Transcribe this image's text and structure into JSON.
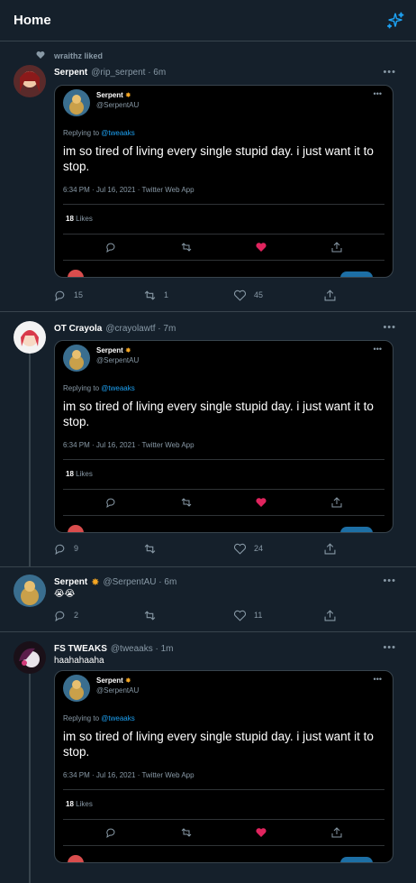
{
  "header": {
    "title": "Home",
    "icon": "sparkle-icon"
  },
  "quoted": {
    "name": "Serpent",
    "handle": "@SerpentAU",
    "replying_prefix": "Replying to",
    "replying_to": "@tweaaks",
    "text": "im so tired of living every single stupid day. i just want it to stop.",
    "meta": "6:34 PM · Jul 16, 2021 · Twitter Web App",
    "likes_count": "18",
    "likes_label": "Likes"
  },
  "tweets": [
    {
      "social": "wraithz liked",
      "name": "Serpent",
      "handle": "@rip_serpent · 6m",
      "replies": "15",
      "retweets": "1",
      "likes": "45"
    },
    {
      "name": "OT Crayola",
      "handle": "@crayolawtf · 7m",
      "replies": "9",
      "retweets": "",
      "likes": "24"
    },
    {
      "name": "Serpent",
      "handle": "@SerpentAU · 6m",
      "text": "😭😭",
      "replies": "2",
      "retweets": "",
      "likes": "11"
    },
    {
      "name": "FS TWEAKS",
      "handle": "@tweaaks · 1m",
      "text": "haahahaaha",
      "replies": "",
      "retweets": "",
      "likes": ""
    }
  ],
  "colors": {
    "bg": "#15202b",
    "accent": "#1da1f2",
    "like": "#e0245e",
    "muted": "#8899a6"
  }
}
